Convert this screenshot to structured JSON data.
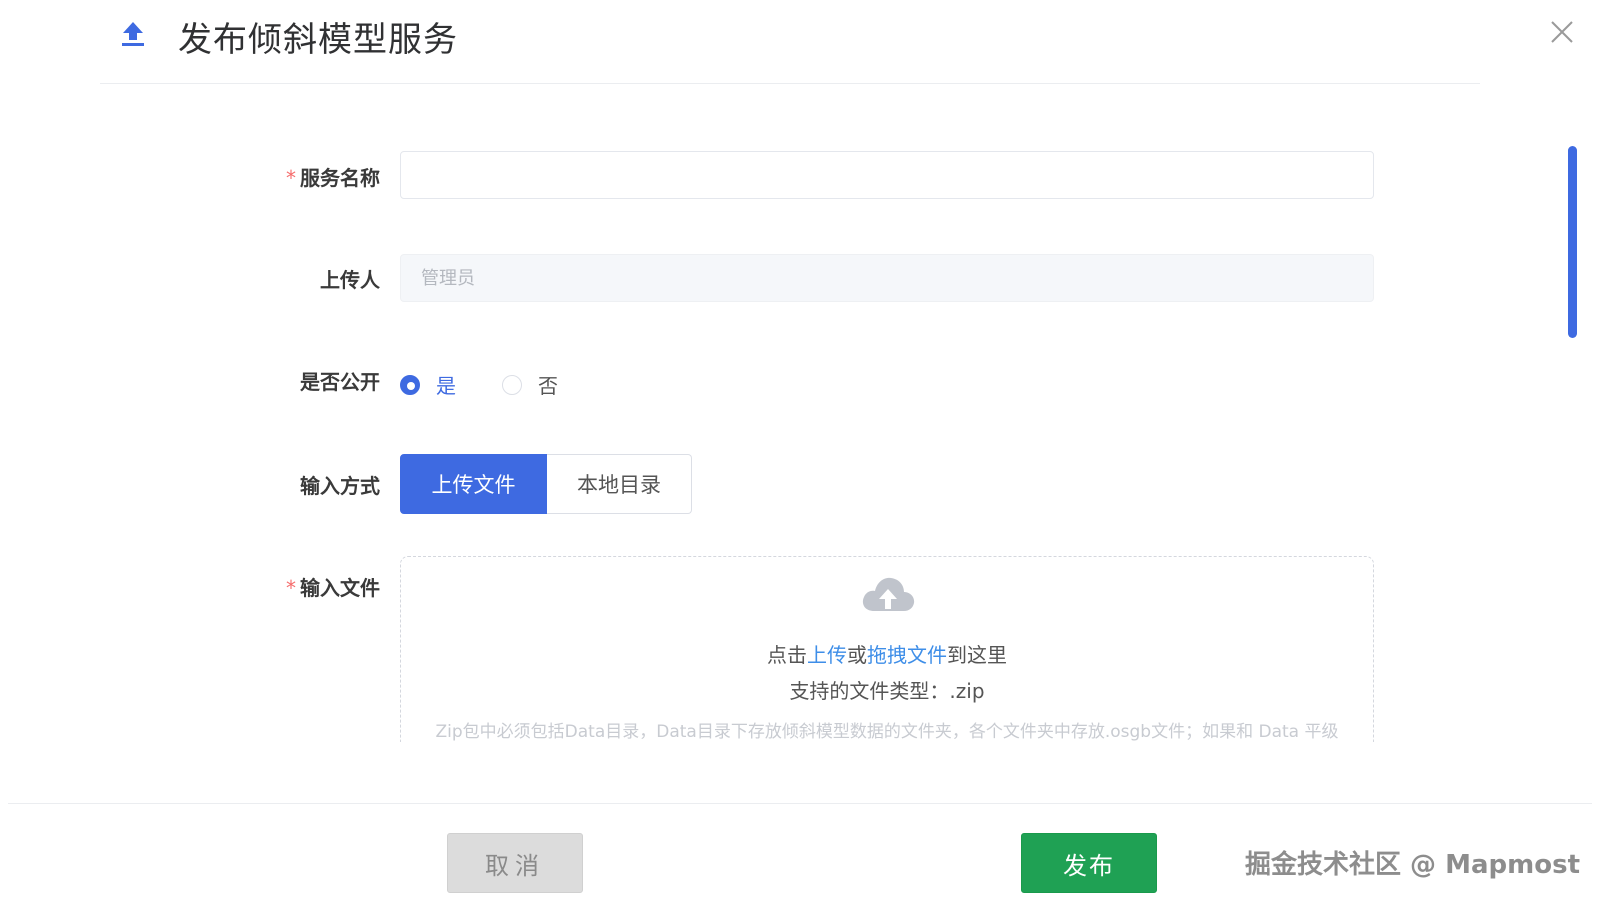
{
  "dialog": {
    "title": "发布倾斜模型服务",
    "accent_color": "#3e6ae1"
  },
  "form": {
    "service_name": {
      "label": "服务名称",
      "required": "*",
      "value": "",
      "placeholder": ""
    },
    "uploader": {
      "label": "上传人",
      "placeholder": "管理员"
    },
    "is_public": {
      "label": "是否公开",
      "options": [
        "是",
        "否"
      ],
      "selected": "是"
    },
    "input_mode": {
      "label": "输入方式",
      "options": [
        "上传文件",
        "本地目录"
      ],
      "selected": "上传文件"
    },
    "input_file": {
      "label": "输入文件",
      "required": "*",
      "text_prefix": "点击",
      "link_upload": "上传",
      "text_or": "或",
      "link_drag": "拖拽文件",
      "text_suffix": "到这里",
      "supported": "支持的文件类型：.zip",
      "hint": "Zip包中必须包括Data目录，Data目录下存放倾斜模型数据的文件夹，各个文件夹中存放.osgb文件；如果和 Data 平级"
    }
  },
  "footer": {
    "cancel_label": "取消",
    "publish_label": "发布",
    "publish_color": "#1fa154"
  },
  "watermark": "掘金技术社区 @ Mapmost",
  "icons": {
    "header": "upload-icon",
    "close": "close-icon",
    "upload_area": "cloud-upload-icon"
  }
}
